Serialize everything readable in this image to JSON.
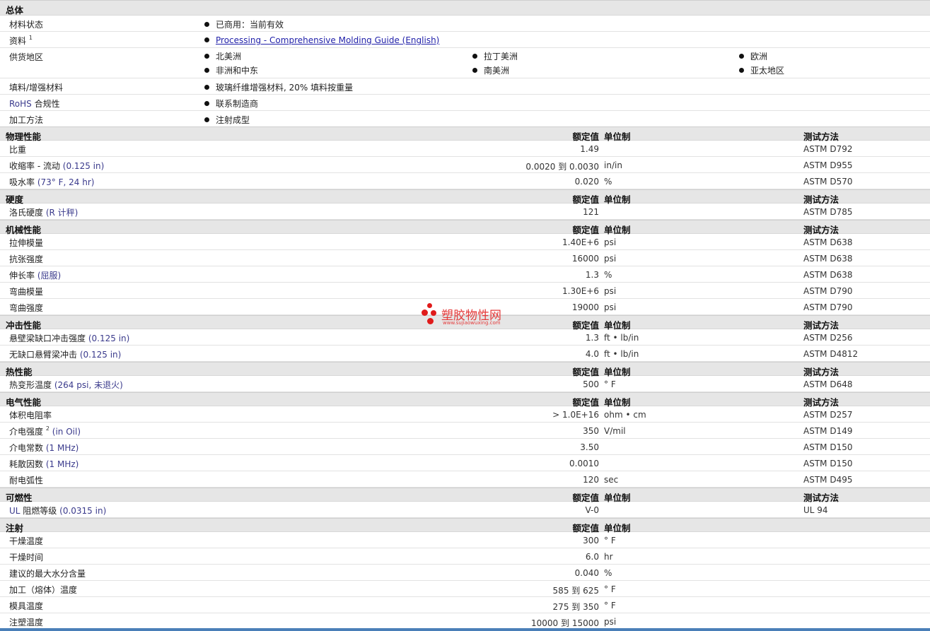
{
  "general": {
    "title": "总体",
    "rows": [
      {
        "label": "材料状态",
        "items": [
          "已商用：当前有效"
        ]
      },
      {
        "label": "资料",
        "sup": "1",
        "items": [
          "Processing - Comprehensive Molding Guide (English)"
        ]
      },
      {
        "label": "供货地区",
        "items": [
          "北美洲",
          "拉丁美洲",
          "欧洲",
          "非洲和中东",
          "南美洲",
          "亚太地区"
        ]
      },
      {
        "label": "填料/增强材料",
        "items": [
          "玻璃纤维增强材料, 20% 填料按重量"
        ]
      },
      {
        "label_prefix": "RoHS",
        "label": "合规性",
        "items": [
          "联系制造商"
        ]
      },
      {
        "label": "加工方法",
        "items": [
          "注射成型"
        ]
      }
    ]
  },
  "headers": {
    "nominal": "额定值",
    "unit": "单位制",
    "test": "测试方法"
  },
  "sections": [
    {
      "title": "物理性能",
      "show_test": true,
      "rows": [
        {
          "label": "比重",
          "cond": "",
          "nom": "1.49",
          "unit": "",
          "test": "ASTM D792"
        },
        {
          "label": "收缩率 - 流动",
          "cond": "(0.125 in)",
          "nom": "0.0020 到  0.0030",
          "unit": "in/in",
          "test": "ASTM D955"
        },
        {
          "label": "吸水率",
          "cond": "(73°  F, 24 hr)",
          "nom": "0.020",
          "unit": "%",
          "test": "ASTM D570"
        }
      ]
    },
    {
      "title": "硬度",
      "show_test": true,
      "rows": [
        {
          "label": "洛氏硬度",
          "cond": "(R 计秤)",
          "nom": "121",
          "unit": "",
          "test": "ASTM D785"
        }
      ]
    },
    {
      "title": "机械性能",
      "show_test": true,
      "rows": [
        {
          "label": "拉伸模量",
          "cond": "",
          "nom": "1.40E+6",
          "unit": "psi",
          "test": "ASTM D638"
        },
        {
          "label": "抗张强度",
          "cond": "",
          "nom": "16000",
          "unit": "psi",
          "test": "ASTM D638"
        },
        {
          "label": "伸长率",
          "cond": "(屈服)",
          "nom": "1.3",
          "unit": "%",
          "test": "ASTM D638"
        },
        {
          "label": "弯曲模量",
          "cond": "",
          "nom": "1.30E+6",
          "unit": "psi",
          "test": "ASTM D790"
        },
        {
          "label": "弯曲强度",
          "cond": "",
          "nom": "19000",
          "unit": "psi",
          "test": "ASTM D790"
        }
      ]
    },
    {
      "title": "冲击性能",
      "show_test": true,
      "rows": [
        {
          "label": "悬壁梁缺口冲击强度",
          "cond": "(0.125 in)",
          "nom": "1.3",
          "unit": "ft • lb/in",
          "test": "ASTM D256"
        },
        {
          "label": "无缺口悬臂梁冲击",
          "cond": "(0.125 in)",
          "nom": "4.0",
          "unit": "ft • lb/in",
          "test": "ASTM D4812"
        }
      ]
    },
    {
      "title": "热性能",
      "show_test": true,
      "rows": [
        {
          "label": "热变形温度",
          "cond": "(264 psi, 未退火)",
          "nom": "500",
          "unit": "°  F",
          "test": "ASTM D648"
        }
      ]
    },
    {
      "title": "电气性能",
      "show_test": true,
      "rows": [
        {
          "label": "体积电阻率",
          "cond": "",
          "nom": "> 1.0E+16",
          "unit": "ohm • cm",
          "test": "ASTM D257"
        },
        {
          "label": "介电强度",
          "sup": "2",
          "cond": "(in Oil)",
          "nom": "350",
          "unit": "V/mil",
          "test": "ASTM D149"
        },
        {
          "label": "介电常数",
          "cond": "(1 MHz)",
          "nom": "3.50",
          "unit": "",
          "test": "ASTM D150"
        },
        {
          "label": "耗散因数",
          "cond": "(1 MHz)",
          "nom": "0.0010",
          "unit": "",
          "test": "ASTM D150"
        },
        {
          "label": "耐电弧性",
          "cond": "",
          "nom": "120",
          "unit": "sec",
          "test": "ASTM D495"
        }
      ]
    },
    {
      "title": "可燃性",
      "show_test": true,
      "rows": [
        {
          "label_prefix": "UL",
          "label": "阻燃等级",
          "cond": "(0.0315 in)",
          "nom": "V-0",
          "unit": "",
          "test": "UL 94"
        }
      ]
    },
    {
      "title": "注射",
      "show_test": false,
      "rows": [
        {
          "label": "干燥温度",
          "cond": "",
          "nom": "300",
          "unit": "°  F",
          "test": ""
        },
        {
          "label": "干燥时间",
          "cond": "",
          "nom": "6.0",
          "unit": "hr",
          "test": ""
        },
        {
          "label": "建议的最大水分含量",
          "cond": "",
          "nom": "0.040",
          "unit": "%",
          "test": ""
        },
        {
          "label": "加工（熔体）温度",
          "cond": "",
          "nom": "585 到  625",
          "unit": "°  F",
          "test": ""
        },
        {
          "label": "模具温度",
          "cond": "",
          "nom": "275 到  350",
          "unit": "°  F",
          "test": ""
        },
        {
          "label": "注塑温度",
          "cond": "",
          "nom": "10000 到  15000",
          "unit": "psi",
          "test": ""
        }
      ]
    }
  ],
  "watermark": {
    "text": "塑胶物性网",
    "url": "www.sujiaowuxing.com"
  }
}
